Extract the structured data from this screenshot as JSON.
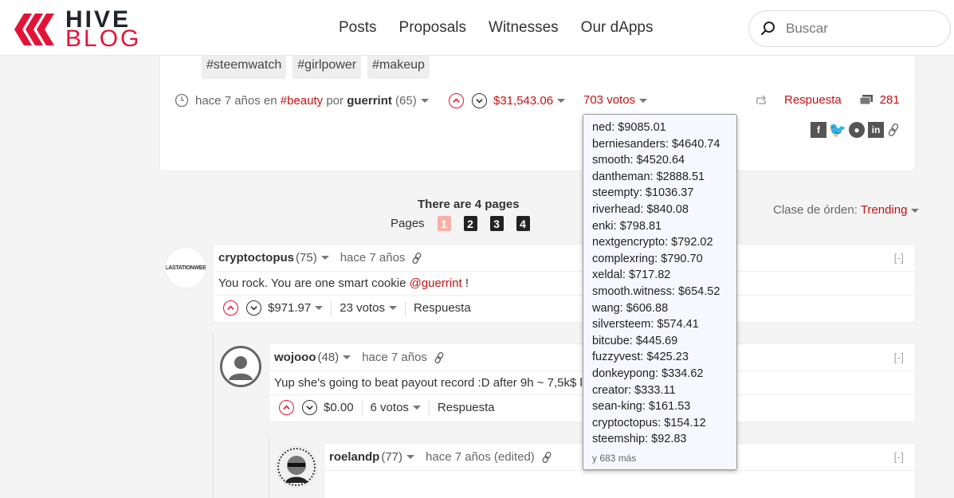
{
  "header": {
    "logo_line1": "HIVE",
    "logo_line2": "BLOG",
    "nav": [
      "Posts",
      "Proposals",
      "Witnesses",
      "Our dApps"
    ],
    "search_placeholder": "Buscar",
    "brand_color": "#e31337"
  },
  "post": {
    "tags": [
      "#steemwatch",
      "#girlpower",
      "#makeup"
    ],
    "time": "hace 7 años en",
    "category": "#beauty",
    "by": "por",
    "author": "guerrint",
    "reputation": "(65)",
    "payout": "$31,543.06",
    "votes": "703 votos",
    "reply_label": "Respuesta",
    "comment_count": "281"
  },
  "pagination": {
    "title": "There are 4 pages",
    "label": "Pages",
    "pages": [
      "1",
      "2",
      "3",
      "4"
    ],
    "active": "1",
    "sort_label": "Clase de órden:",
    "sort_value": "Trending"
  },
  "comments": [
    {
      "author": "cryptoctopus",
      "rep": "(75)",
      "time": "hace 7 años",
      "body_text": "You rock. You are one smart cookie ",
      "body_mention": "@guerrint",
      "body_tail": " !",
      "payout": "$971.97",
      "votes": "23 votos",
      "reply": "Respuesta",
      "collapse": "[-]",
      "avatar_label": "LASTATIONWEB"
    },
    {
      "author": "wojooo",
      "rep": "(48)",
      "time": "hace 7 años",
      "body_text": "Yup she's going to beat payout record :D after 9h ~ 7,5k$ lo",
      "payout": "$0.00",
      "votes": "6 votos",
      "reply": "Respuesta",
      "collapse": "[-]"
    },
    {
      "author": "roelandp",
      "rep": "(77)",
      "time": "hace 7 años (edited)",
      "collapse": "[-]"
    }
  ],
  "voters": [
    "ned: $9085.01",
    "berniesanders: $4640.74",
    "smooth: $4520.64",
    "dantheman: $2888.51",
    "steempty: $1036.37",
    "riverhead: $840.08",
    "enki: $798.81",
    "nextgencrypto: $792.02",
    "complexring: $790.70",
    "xeldal: $717.82",
    "smooth.witness: $654.52",
    "wang: $606.88",
    "silversteem: $574.41",
    "bitcube: $445.69",
    "fuzzyvest: $425.23",
    "donkeypong: $334.62",
    "creator: $333.11",
    "sean-king: $161.53",
    "cryptoctopus: $154.12",
    "steemship: $92.83"
  ],
  "voters_more": "y 683 más"
}
